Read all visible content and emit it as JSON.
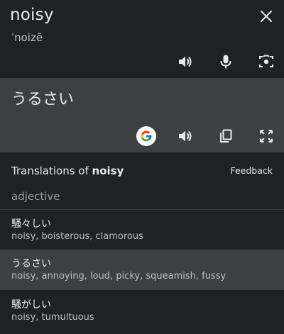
{
  "source": {
    "word": "noisy",
    "phonetic": "ˈnoizē",
    "icons": [
      "close-icon",
      "speaker-icon",
      "microphone-icon",
      "camera-search-icon"
    ]
  },
  "target": {
    "word": "うるさい",
    "icons": [
      "google-g-icon",
      "speaker-icon",
      "copy-icon",
      "fullscreen-icon"
    ]
  },
  "translations": {
    "heading_prefix": "Translations of ",
    "heading_word": "noisy",
    "feedback_label": "Feedback",
    "part_of_speech": "adjective",
    "entries": [
      {
        "word": "騒々しい",
        "meanings": "noisy, boisterous, clamorous"
      },
      {
        "word": "うるさい",
        "meanings": "noisy, annoying, loud, picky, squeamish, fussy"
      },
      {
        "word": "騒がしい",
        "meanings": "noisy, tumultuous"
      }
    ]
  },
  "colors": {
    "background": "#202124",
    "target_panel": "#3c4043",
    "selected_row": "#3c4043",
    "text": "#e8eaed",
    "muted_text": "#9aa0a6"
  }
}
